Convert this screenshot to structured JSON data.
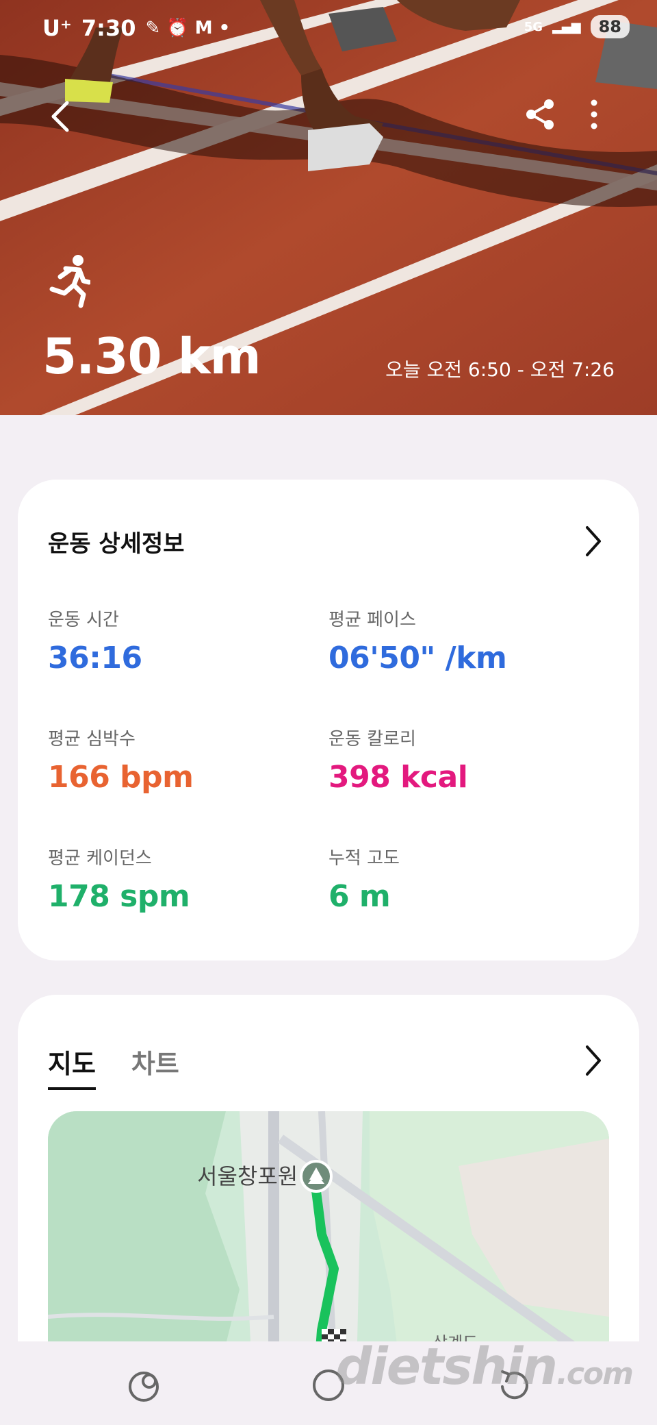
{
  "status_bar": {
    "carrier": "U⁺",
    "time": "7:30",
    "network": "5G",
    "battery": "88"
  },
  "hero": {
    "distance": "5.30 km",
    "time_range": "오늘 오전 6:50 - 오전 7:26",
    "activity_icon": "running-icon"
  },
  "details": {
    "title": "운동 상세정보",
    "metrics": [
      {
        "label": "운동 시간",
        "value": "36:16",
        "color": "#2f6bdd"
      },
      {
        "label": "평균 페이스",
        "value": "06'50\" /km",
        "color": "#2f6bdd"
      },
      {
        "label": "평균 심박수",
        "value": "166 bpm",
        "color": "#e86331"
      },
      {
        "label": "운동 칼로리",
        "value": "398 kcal",
        "color": "#e3197e"
      },
      {
        "label": "평균 케이던스",
        "value": "178 spm",
        "color": "#1fb06a"
      },
      {
        "label": "누적 고도",
        "value": "6 m",
        "color": "#1fb06a"
      }
    ]
  },
  "map_section": {
    "tabs": [
      {
        "label": "지도",
        "active": true
      },
      {
        "label": "차트",
        "active": false
      }
    ],
    "map_label": "서울창포원",
    "map_label_2": "상계도"
  },
  "watermark": {
    "main": "dietshin",
    "suffix": ".com"
  }
}
